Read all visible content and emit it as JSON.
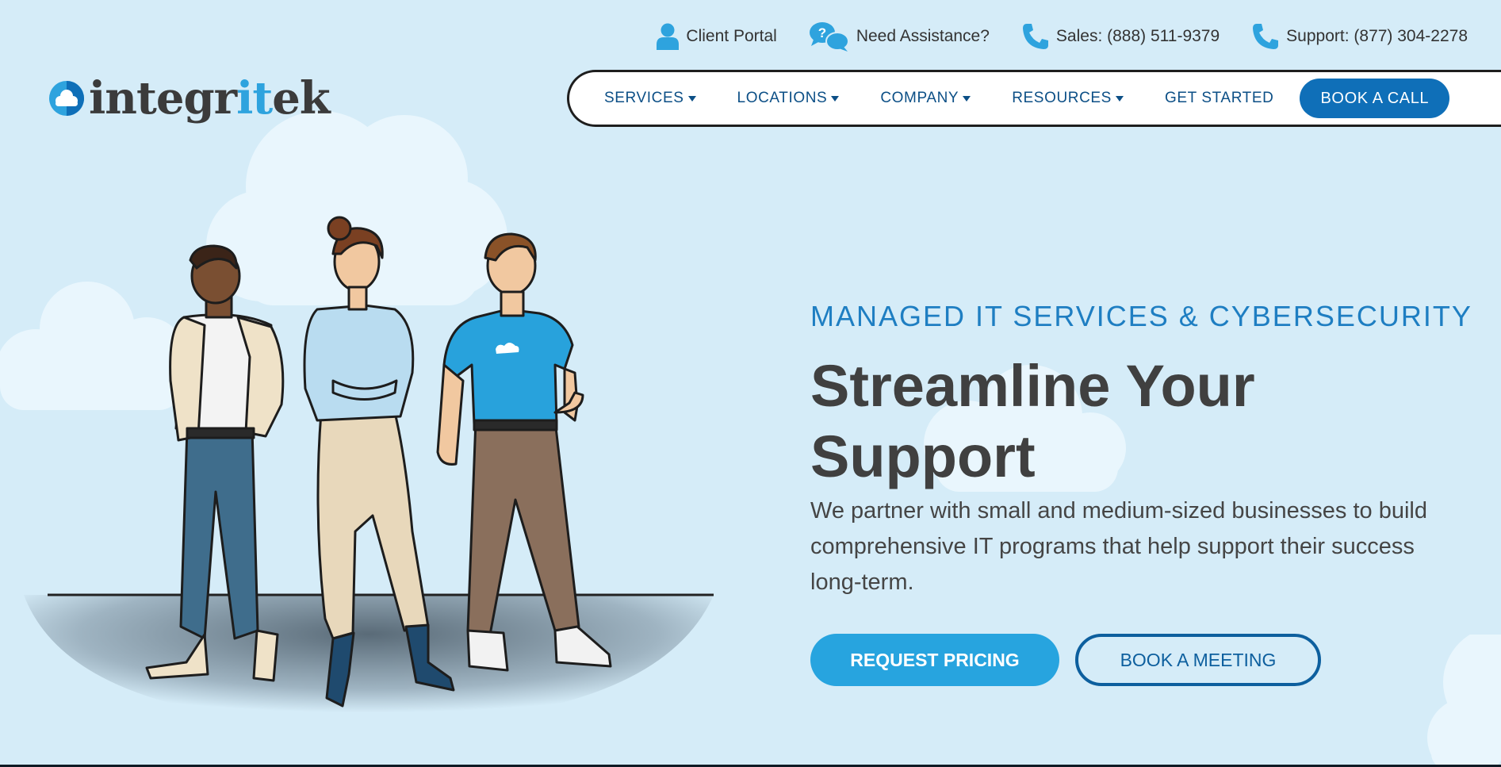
{
  "utility_bar": {
    "client_portal": "Client Portal",
    "need_assistance": "Need Assistance?",
    "sales": "Sales: (888) 511-9379",
    "support": "Support: (877) 304-2278"
  },
  "logo": {
    "part1": "integr",
    "part2": "it",
    "part3": "ek"
  },
  "nav": {
    "services": "SERVICES",
    "locations": "LOCATIONS",
    "company": "COMPANY",
    "resources": "RESOURCES",
    "get_started": "GET STARTED",
    "book_call": "BOOK A CALL"
  },
  "hero": {
    "eyebrow": "MANAGED IT SERVICES & CYBERSECURITY",
    "headline_line1": "Streamline Your",
    "headline_line2": "Support",
    "lede": "We partner with small and medium-sized businesses to build comprehensive IT programs that help support their success long-term.",
    "primary_cta": "REQUEST PRICING",
    "secondary_cta": "BOOK A MEETING"
  },
  "colors": {
    "background": "#d5ecf8",
    "brand_blue": "#2ea3de",
    "nav_text": "#0c4f86",
    "button_dark": "#0f6fb8",
    "heading": "#404040"
  },
  "icons": [
    "user-icon",
    "chat-question-icon",
    "phone-icon",
    "cloud-logo-icon",
    "caret-down-icon"
  ]
}
